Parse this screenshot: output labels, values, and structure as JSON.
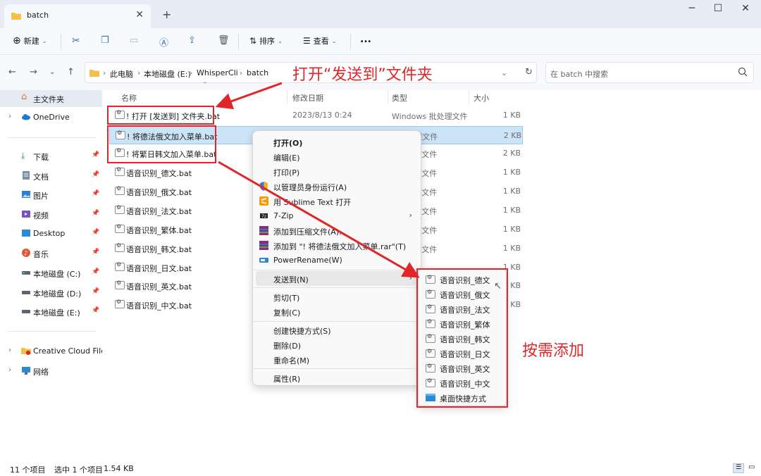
{
  "window": {
    "tab_title": "batch",
    "colors": {
      "titlebar": "#e8edf5",
      "toolbar": "#f7f9fc",
      "selection": "#cce4f7",
      "annotation": "#e0262b"
    }
  },
  "toolbar": {
    "new_label": "新建",
    "sort_label": "排序",
    "view_label": "查看",
    "more_label": "..."
  },
  "address": {
    "crumbs": [
      "此电脑",
      "本地磁盘 (E:)",
      "WhisperCli",
      "batch"
    ],
    "search_placeholder": "在 batch 中搜索"
  },
  "sidebar": {
    "items": [
      {
        "label": "主文件夹",
        "icon": "home-icon"
      },
      {
        "label": "OneDrive",
        "icon": "cloud-icon"
      },
      {
        "label": "下载",
        "icon": "download-icon"
      },
      {
        "label": "文档",
        "icon": "document-icon"
      },
      {
        "label": "图片",
        "icon": "picture-icon"
      },
      {
        "label": "视频",
        "icon": "video-icon"
      },
      {
        "label": "Desktop",
        "icon": "desktop-icon"
      },
      {
        "label": "音乐",
        "icon": "music-icon"
      },
      {
        "label": "本地磁盘 (C:)",
        "icon": "drive-icon"
      },
      {
        "label": "本地磁盘 (D:)",
        "icon": "drive-icon"
      },
      {
        "label": "本地磁盘 (E:)",
        "icon": "drive-icon"
      },
      {
        "label": "Creative Cloud Files",
        "icon": "creative-cloud-icon"
      },
      {
        "label": "网络",
        "icon": "network-icon"
      }
    ]
  },
  "list": {
    "headers": {
      "name": "名称",
      "date": "修改日期",
      "type": "类型",
      "size": "大小"
    },
    "rows": [
      {
        "name": "! 打开 [发送到] 文件夹.bat",
        "date": "2023/8/13 0:24",
        "type": "Windows 批处理文件",
        "size": "1 KB"
      },
      {
        "name": "! 将德法俄文加入菜单.bat",
        "date": "",
        "type": "s 批处理文件",
        "size": "2 KB"
      },
      {
        "name": "! 将繁日韩文加入菜单.bat",
        "date": "",
        "type": "s 批处理文件",
        "size": "2 KB"
      },
      {
        "name": "语音识别_德文.bat",
        "date": "",
        "type": "s 批处理文件",
        "size": "1 KB"
      },
      {
        "name": "语音识别_俄文.bat",
        "date": "",
        "type": "s 批处理文件",
        "size": "1 KB"
      },
      {
        "name": "语音识别_法文.bat",
        "date": "",
        "type": "s 批处理文件",
        "size": "1 KB"
      },
      {
        "name": "语音识别_繁体.bat",
        "date": "",
        "type": "s 批处理文件",
        "size": "1 KB"
      },
      {
        "name": "语音识别_韩文.bat",
        "date": "",
        "type": "s 批处理文件",
        "size": "1 KB"
      },
      {
        "name": "语音识别_日文.bat",
        "date": "",
        "type": "",
        "size": "1 KB"
      },
      {
        "name": "语音识别_英文.bat",
        "date": "",
        "type": "",
        "size": "KB"
      },
      {
        "name": "语音识别_中文.bat",
        "date": "",
        "type": "",
        "size": "KB"
      }
    ]
  },
  "context_menu": {
    "items": [
      {
        "label": "打开(O)",
        "bold": true
      },
      {
        "label": "编辑(E)"
      },
      {
        "label": "打印(P)"
      },
      {
        "label": "以管理员身份运行(A)",
        "icon": "shield-icon"
      },
      {
        "label": "用 Sublime Text 打开",
        "icon": "sublime-icon"
      },
      {
        "label": "7-Zip",
        "icon": "7zip-icon",
        "arrow": "›"
      },
      {
        "label": "添加到压缩文件(A)...",
        "icon": "winrar-icon"
      },
      {
        "label": "添加到 \"! 将德法俄文加入菜单.rar\"(T)",
        "icon": "winrar-icon"
      },
      {
        "label": "PowerRename(W)",
        "icon": "powerrename-icon"
      },
      {
        "label": "发送到(N)",
        "arrow": "›"
      },
      {
        "label": "剪切(T)"
      },
      {
        "label": "复制(C)"
      },
      {
        "label": "创建快捷方式(S)"
      },
      {
        "label": "删除(D)"
      },
      {
        "label": "重命名(M)"
      },
      {
        "label": "属性(R)"
      }
    ]
  },
  "send_to": {
    "items": [
      {
        "label": "语音识别_德文"
      },
      {
        "label": "语音识别_俄文"
      },
      {
        "label": "语音识别_法文"
      },
      {
        "label": "语音识别_繁体"
      },
      {
        "label": "语音识别_韩文"
      },
      {
        "label": "语音识别_日文"
      },
      {
        "label": "语音识别_英文"
      },
      {
        "label": "语音识别_中文"
      },
      {
        "label": "桌面快捷方式"
      }
    ]
  },
  "status": {
    "count": "11 个项目",
    "selection": "选中 1 个项目",
    "size": "1.54 KB"
  },
  "annotations": {
    "open_sendto": "打开“发送到”文件夹",
    "add_as_needed": "按需添加"
  }
}
